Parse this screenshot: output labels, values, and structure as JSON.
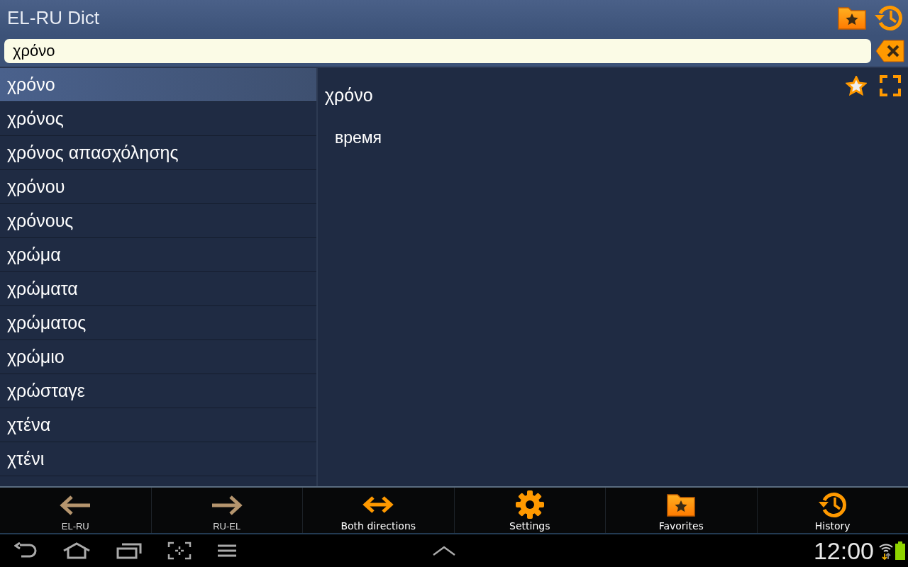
{
  "app_bar": {
    "title": "EL-RU Dict"
  },
  "search": {
    "value": "χρόνο"
  },
  "word_list": [
    {
      "label": "χρόνο",
      "selected": true
    },
    {
      "label": "χρόνος",
      "selected": false
    },
    {
      "label": "χρόνος απασχόλησης",
      "selected": false
    },
    {
      "label": "χρόνου",
      "selected": false
    },
    {
      "label": "χρόνους",
      "selected": false
    },
    {
      "label": "χρώμα",
      "selected": false
    },
    {
      "label": "χρώματα",
      "selected": false
    },
    {
      "label": "χρώματος",
      "selected": false
    },
    {
      "label": "χρώμιο",
      "selected": false
    },
    {
      "label": "χρώσταγε",
      "selected": false
    },
    {
      "label": "χτένα",
      "selected": false
    },
    {
      "label": "χτένι",
      "selected": false
    }
  ],
  "entry": {
    "headword": "χρόνο",
    "translation": "время"
  },
  "toolbar": [
    {
      "kind": "left",
      "label": "EL-RU",
      "selected": false
    },
    {
      "kind": "right",
      "label": "RU-EL",
      "selected": false
    },
    {
      "kind": "both",
      "label": "Both directions",
      "selected": true
    },
    {
      "kind": "settings",
      "label": "Settings"
    },
    {
      "kind": "favorites",
      "label": "Favorites"
    },
    {
      "kind": "history",
      "label": "History"
    }
  ],
  "status_bar": {
    "time": "12:00"
  }
}
